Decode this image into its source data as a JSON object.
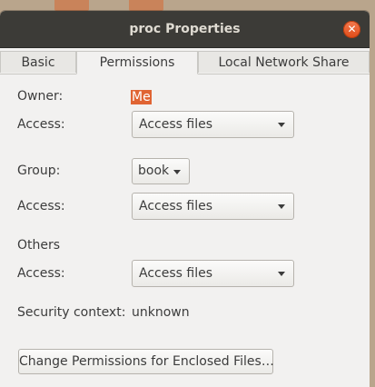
{
  "window": {
    "title": "proc Properties"
  },
  "tabs": [
    {
      "label": "Basic",
      "active": false
    },
    {
      "label": "Permissions",
      "active": true
    },
    {
      "label": "Local Network Share",
      "active": false
    }
  ],
  "permissions": {
    "owner_label": "Owner:",
    "owner_value": "Me",
    "owner_access_label": "Access:",
    "owner_access_value": "Access files",
    "group_label": "Group:",
    "group_value": "book",
    "group_access_label": "Access:",
    "group_access_value": "Access files",
    "others_label": "Others",
    "others_access_label": "Access:",
    "others_access_value": "Access files",
    "security_context_label": "Security context:",
    "security_context_value": "unknown",
    "change_button_label": "Change Permissions for Enclosed Files…"
  },
  "colors": {
    "titlebar": "#3c3b37",
    "close_button": "#e95420",
    "selection_highlight": "#e06433",
    "window_bg": "#f2f1f0"
  },
  "icons": {
    "close": "close-icon",
    "dropdown": "chevron-down-icon"
  }
}
